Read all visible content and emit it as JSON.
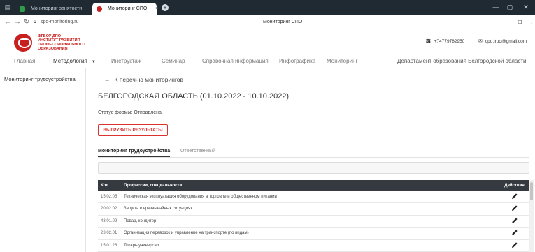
{
  "browser": {
    "tabs": [
      {
        "label": "Мониторинг занятости",
        "fav_color": "#2e9d4a",
        "active": false
      },
      {
        "label": "Мониторинг СПО",
        "fav_color": "#c8201e",
        "active": true
      }
    ],
    "new_tab": "+",
    "url": "spo-monitoring.ru",
    "page_title": "Мониторинг СПО",
    "window_controls": [
      "—",
      "▢",
      "✕"
    ]
  },
  "header": {
    "org_lines": [
      "ФГБОУ ДПО",
      "ИНСТИТУТ РАЗВИТИЯ",
      "ПРОФЕССИОНАЛЬНОГО",
      "ОБРАЗОВАНИЯ"
    ],
    "phone": "+74779782950",
    "email": "cpo.irpo@gmail.com",
    "brand_color": "#c8201e"
  },
  "menu": {
    "items": [
      {
        "label": "Главная"
      },
      {
        "label": "Методология"
      },
      {
        "label": "Инструктаж"
      },
      {
        "label": "Семинар"
      },
      {
        "label": "Справочная информация"
      },
      {
        "label": "Инфографика"
      },
      {
        "label": "Мониторинг"
      }
    ],
    "right": "Департамент образования Белгородской области"
  },
  "sidebar": {
    "items": [
      {
        "label": "Мониторинг трудоустройства"
      }
    ]
  },
  "main": {
    "back_label": "К перечню мониторингов",
    "title": "БЕЛГОРОДСКАЯ ОБЛАСТЬ (01.10.2022 - 10.10.2022)",
    "status": "Статус формы: Отправлена",
    "export_label": "ВЫГРУЗИТЬ РЕЗУЛЬТАТЫ",
    "tabs": [
      {
        "label": "Мониторинг трудоустройства",
        "active": true
      },
      {
        "label": "Ответственный",
        "active": false
      }
    ],
    "table": {
      "headers": {
        "code": "Код",
        "name": "Профессии, специальности",
        "action": "Действия"
      },
      "rows": [
        {
          "code": "15.02.05",
          "name": "Техническая эксплуатация оборудования в торговле и общественном питании"
        },
        {
          "code": "20.02.02",
          "name": "Защита в чрезвычайных ситуациях"
        },
        {
          "code": "43.01.09",
          "name": "Повар, кондитер"
        },
        {
          "code": "23.02.01",
          "name": "Организация перевозок и управление на транспорте (по видам)"
        },
        {
          "code": "15.01.26",
          "name": "Токарь-универсал"
        }
      ]
    }
  }
}
